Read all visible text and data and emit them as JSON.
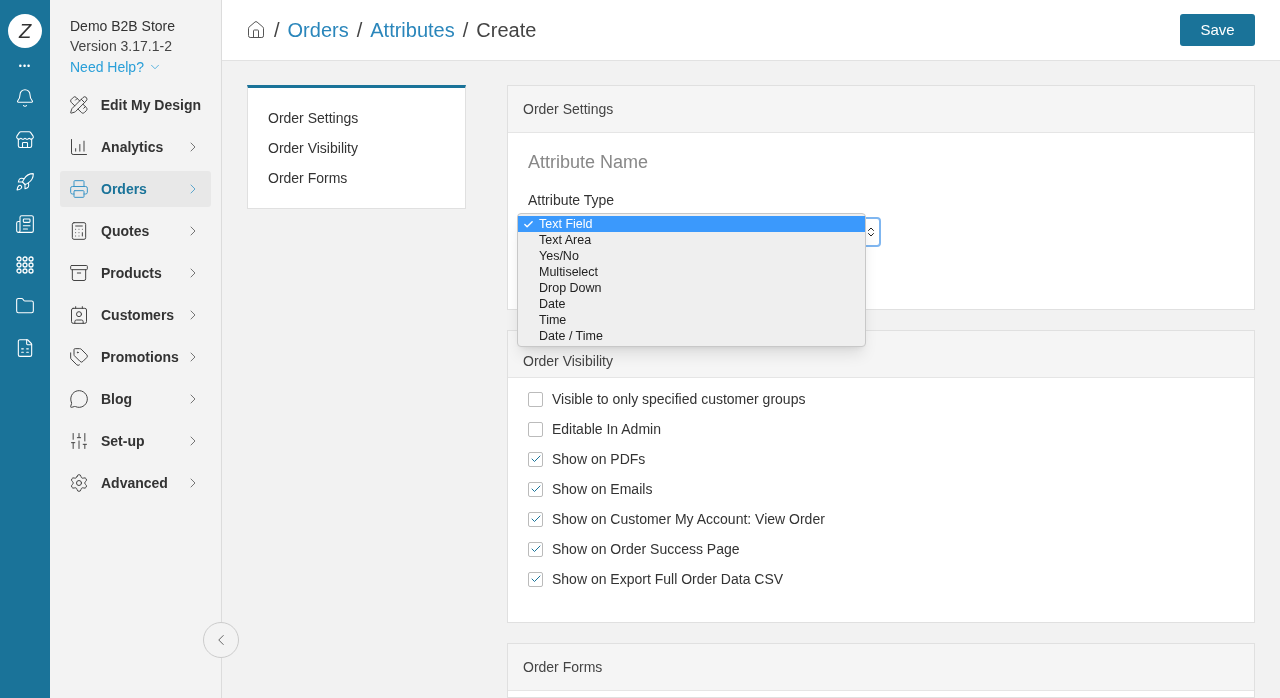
{
  "rail": {
    "logo": "Z",
    "more": "•••"
  },
  "store": {
    "name": "Demo B2B Store",
    "version": "Version 3.17.1-2",
    "help": "Need Help?"
  },
  "sidebar": {
    "items": [
      {
        "label": "Edit My Design",
        "selected": false
      },
      {
        "label": "Analytics",
        "selected": false
      },
      {
        "label": "Orders",
        "selected": true
      },
      {
        "label": "Quotes",
        "selected": false
      },
      {
        "label": "Products",
        "selected": false
      },
      {
        "label": "Customers",
        "selected": false
      },
      {
        "label": "Promotions",
        "selected": false
      },
      {
        "label": "Blog",
        "selected": false
      },
      {
        "label": "Set-up",
        "selected": false
      },
      {
        "label": "Advanced",
        "selected": false
      }
    ]
  },
  "breadcrumb": [
    {
      "separator": "/",
      "label": "Orders",
      "link": true
    },
    {
      "separator": "/",
      "label": "Attributes",
      "link": true
    },
    {
      "separator": "/",
      "label": "Create",
      "link": false
    }
  ],
  "save_button": "Save",
  "section_nav": [
    "Order Settings",
    "Order Visibility",
    "Order Forms"
  ],
  "order_settings": {
    "title": "Order Settings",
    "name_field": {
      "placeholder": "Attribute Name"
    },
    "type_label": "Attribute Type",
    "dropdown": {
      "open": true,
      "options": [
        {
          "label": "Text Field",
          "selected": true
        },
        {
          "label": "Text Area",
          "selected": false
        },
        {
          "label": "Yes/No",
          "selected": false
        },
        {
          "label": "Multiselect",
          "selected": false
        },
        {
          "label": "Drop Down",
          "selected": false
        },
        {
          "label": "Date",
          "selected": false
        },
        {
          "label": "Time",
          "selected": false
        },
        {
          "label": "Date / Time",
          "selected": false
        }
      ]
    }
  },
  "order_visibility": {
    "title": "Order Visibility",
    "options": [
      {
        "label": "Visible to only specified customer groups",
        "checked": false
      },
      {
        "label": "Editable In Admin",
        "checked": false
      },
      {
        "label": "Show on PDFs",
        "checked": true
      },
      {
        "label": "Show on Emails",
        "checked": true
      },
      {
        "label": "Show on Customer My Account: View Order",
        "checked": true
      },
      {
        "label": "Show on Order Success Page",
        "checked": true
      },
      {
        "label": "Show on Export Full Order Data CSV",
        "checked": true
      }
    ]
  },
  "order_forms": {
    "title": "Order Forms"
  }
}
